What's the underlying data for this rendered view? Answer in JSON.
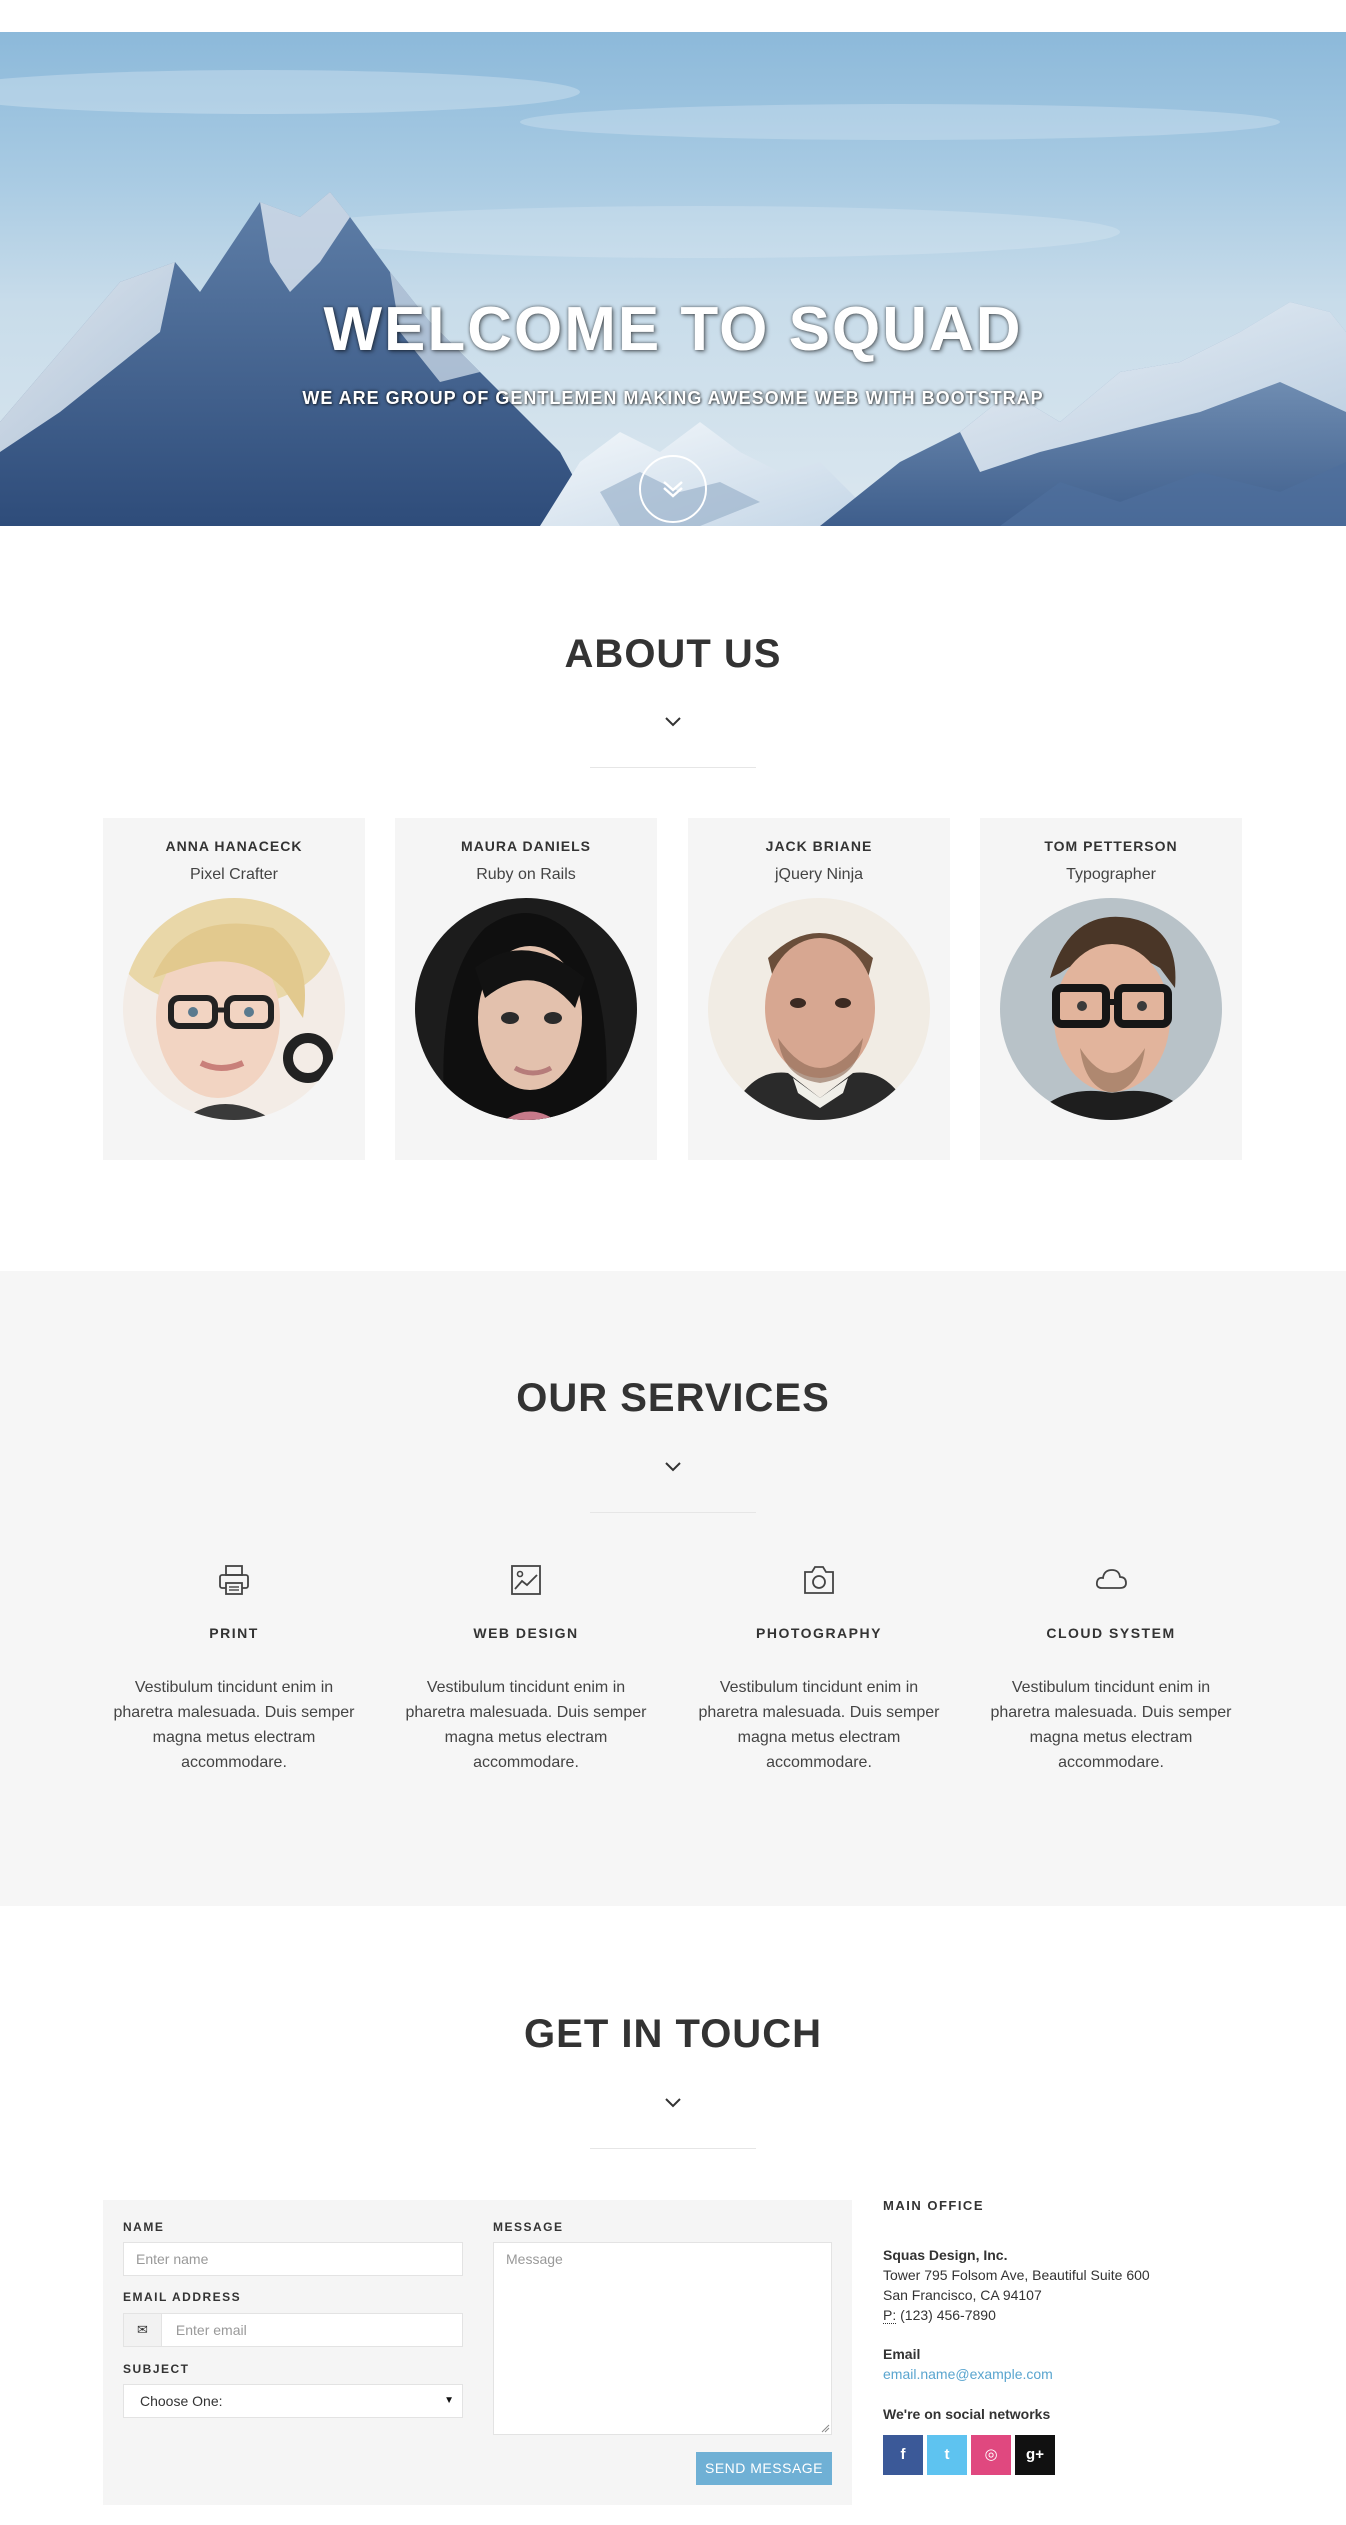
{
  "hero": {
    "title": "WELCOME TO SQUAD",
    "subtitle": "WE ARE GROUP OF GENTLEMEN MAKING AWESOME WEB WITH BOOTSTRAP"
  },
  "about": {
    "title": "ABOUT US",
    "team": [
      {
        "name": "ANNA HANACECK",
        "role": "Pixel Crafter"
      },
      {
        "name": "MAURA DANIELS",
        "role": "Ruby on Rails"
      },
      {
        "name": "JACK BRIANE",
        "role": "jQuery Ninja"
      },
      {
        "name": "TOM PETTERSON",
        "role": "Typographer"
      }
    ]
  },
  "services": {
    "title": "OUR SERVICES",
    "items": [
      {
        "icon": "printer-icon",
        "title": "PRINT",
        "desc": "Vestibulum tincidunt enim in pharetra malesuada. Duis semper magna metus electram accommodare."
      },
      {
        "icon": "image-icon",
        "title": "WEB DESIGN",
        "desc": "Vestibulum tincidunt enim in pharetra malesuada. Duis semper magna metus electram accommodare."
      },
      {
        "icon": "camera-icon",
        "title": "PHOTOGRAPHY",
        "desc": "Vestibulum tincidunt enim in pharetra malesuada. Duis semper magna metus electram accommodare."
      },
      {
        "icon": "cloud-icon",
        "title": "CLOUD SYSTEM",
        "desc": "Vestibulum tincidunt enim in pharetra malesuada. Duis semper magna metus electram accommodare."
      }
    ]
  },
  "contact": {
    "title": "GET IN TOUCH",
    "form": {
      "name_label": "NAME",
      "name_placeholder": "Enter name",
      "email_label": "EMAIL ADDRESS",
      "email_placeholder": "Enter email",
      "subject_label": "SUBJECT",
      "subject_value": "Choose One:",
      "message_label": "MESSAGE",
      "message_placeholder": "Message",
      "send_label": "SEND MESSAGE"
    },
    "office": {
      "heading": "MAIN OFFICE",
      "company": "Squas Design, Inc.",
      "address1": "Tower 795 Folsom Ave, Beautiful Suite 600",
      "address2": "San Francisco, CA 94107",
      "phone_prefix": "P:",
      "phone": "(123) 456-7890",
      "email_heading": "Email",
      "email": "email.name@example.com",
      "social_heading": "We're on social networks"
    },
    "social": [
      {
        "icon": "facebook-icon",
        "glyph": "f",
        "color": "#3b5998"
      },
      {
        "icon": "twitter-icon",
        "glyph": "t",
        "color": "#5ec3f0"
      },
      {
        "icon": "dribbble-icon",
        "glyph": "◎",
        "color": "#e0487f"
      },
      {
        "icon": "google-plus-icon",
        "glyph": "g+",
        "color": "#111111"
      }
    ]
  },
  "colors": {
    "accent": "#6fb0d5",
    "section_bg": "#f6f6f6",
    "card_bg": "#f5f5f5",
    "link": "#5aa5cf"
  }
}
